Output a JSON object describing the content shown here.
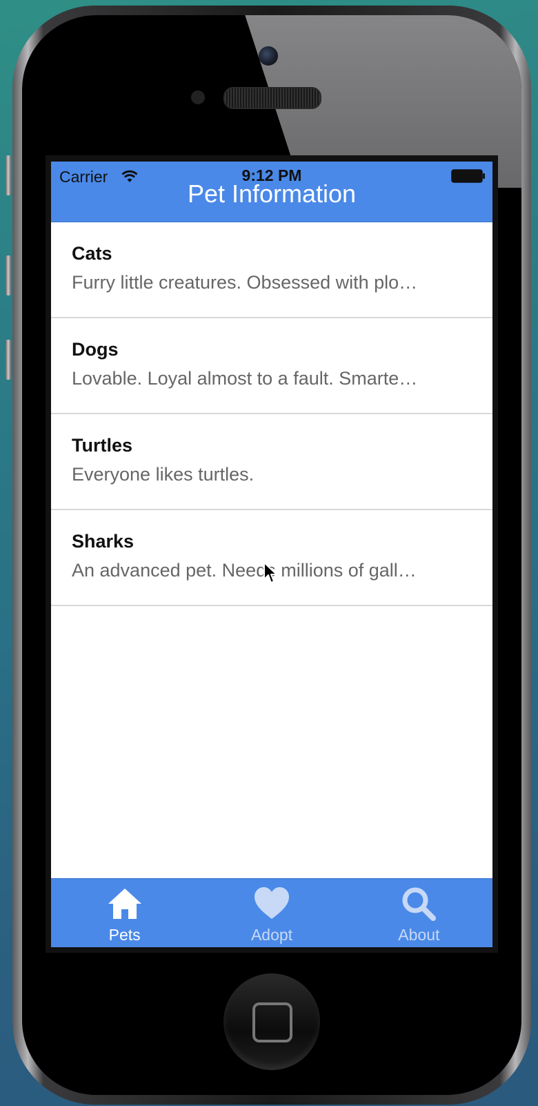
{
  "status_bar": {
    "carrier": "Carrier",
    "time": "9:12 PM"
  },
  "navbar": {
    "title": "Pet Information"
  },
  "pets": [
    {
      "name": "Cats",
      "description": "Furry little creatures. Obsessed with plo…"
    },
    {
      "name": "Dogs",
      "description": "Lovable. Loyal almost to a fault. Smarte…"
    },
    {
      "name": "Turtles",
      "description": "Everyone likes turtles."
    },
    {
      "name": "Sharks",
      "description": "An advanced pet. Needs millions of gall…"
    }
  ],
  "tabs": [
    {
      "label": "Pets",
      "icon": "home-icon",
      "active": true
    },
    {
      "label": "Adopt",
      "icon": "heart-icon",
      "active": false
    },
    {
      "label": "About",
      "icon": "search-icon",
      "active": false
    }
  ],
  "colors": {
    "accent": "#4a89e8",
    "tab_active": "#ffffff",
    "tab_inactive": "#c7d9f7"
  }
}
